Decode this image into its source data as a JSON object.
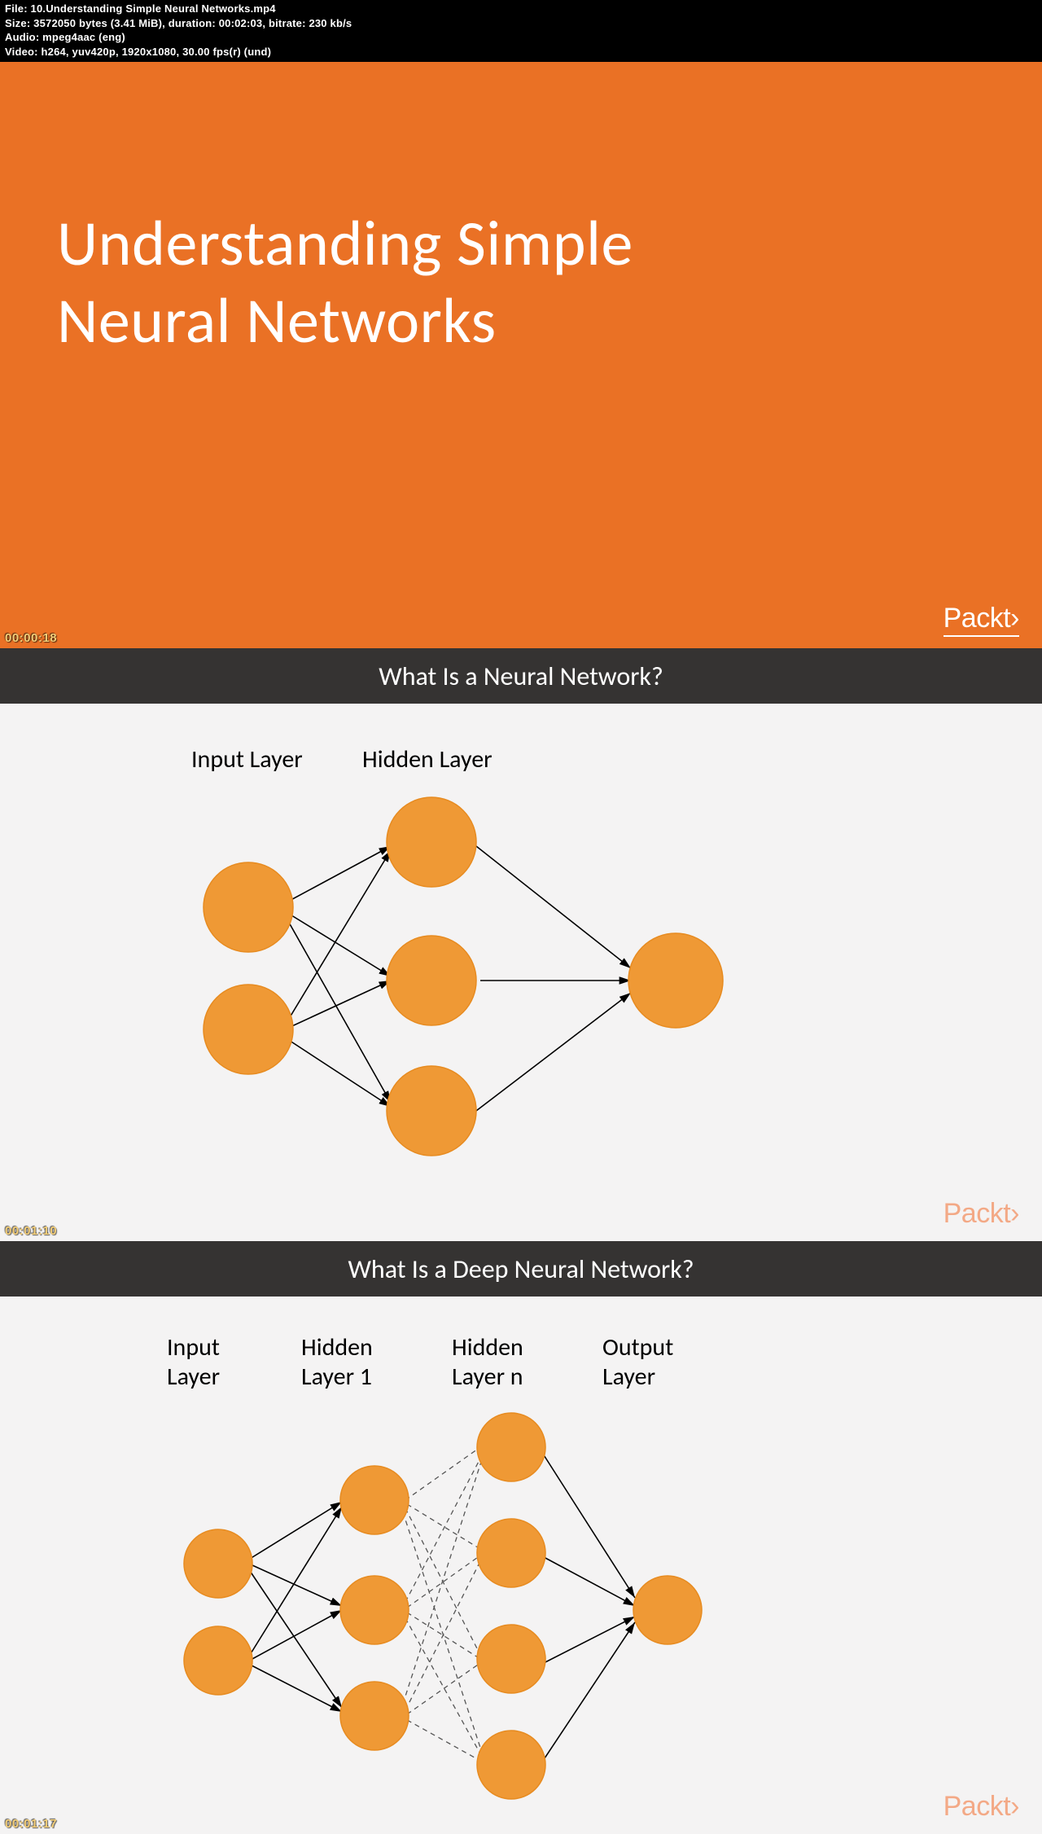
{
  "meta": {
    "file_line": "File: 10.Understanding Simple Neural Networks.mp4",
    "size_line": "Size: 3572050 bytes (3.41 MiB), duration: 00:02:03, bitrate: 230 kb/s",
    "audio_line": "Audio: mpeg4aac (eng)",
    "video_line": "Video: h264, yuv420p, 1920x1080, 30.00 fps(r) (und)"
  },
  "timestamps": {
    "t1": "00:00:18",
    "t2": "00:01:10",
    "t3": "00:01:17"
  },
  "brand": {
    "name": "Packt",
    "glyph": "›"
  },
  "title_slide": {
    "line1": "Understanding Simple",
    "line2": "Neural Networks"
  },
  "section1": {
    "heading": "What Is a Neural Network?",
    "labels": {
      "input": "Input Layer",
      "hidden": "Hidden Layer"
    }
  },
  "section2": {
    "heading": "What Is a Deep Neural Network?",
    "labels": {
      "input_l1": "Input",
      "input_l2": "Layer",
      "h1_l1": "Hidden",
      "h1_l2": "Layer 1",
      "hn_l1": "Hidden",
      "hn_l2": "Layer n",
      "out_l1": "Output",
      "out_l2": "Layer"
    }
  }
}
